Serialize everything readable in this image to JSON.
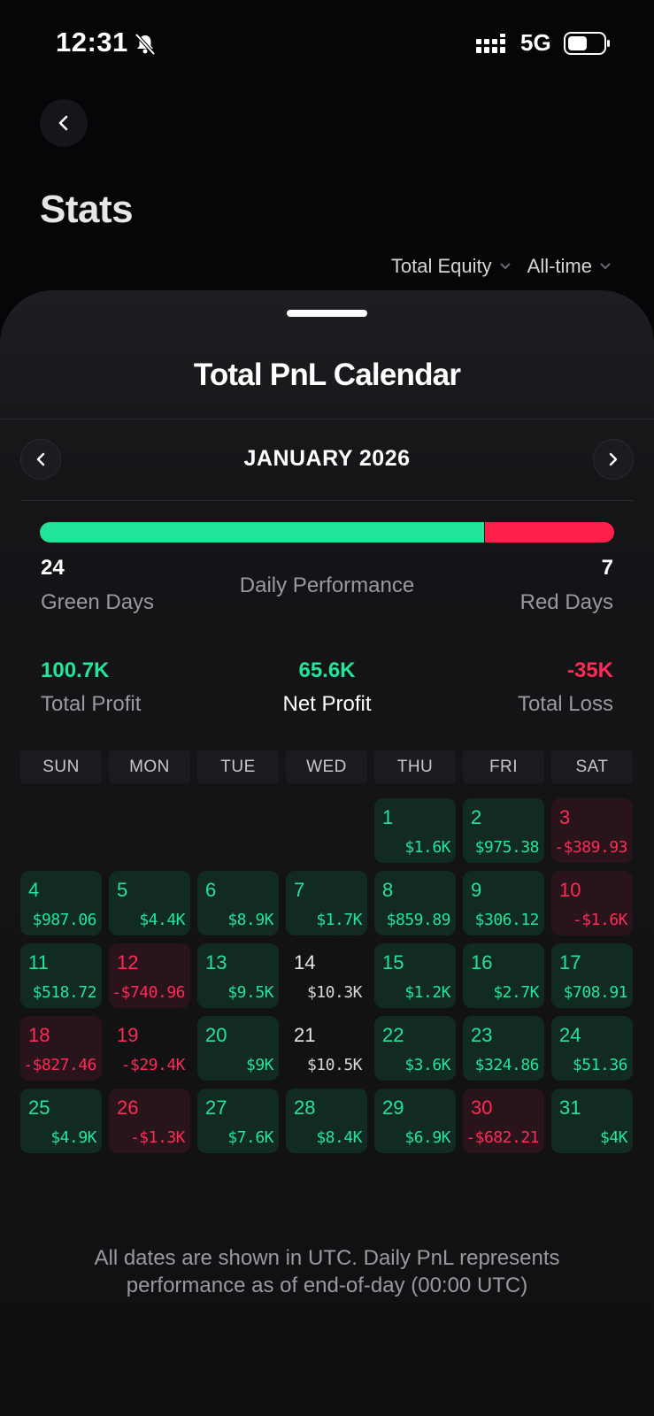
{
  "status_bar": {
    "time": "12:31",
    "network": "5G"
  },
  "header": {
    "title": "Stats"
  },
  "filters": {
    "metric": "Total Equity",
    "range": "All-time"
  },
  "sheet": {
    "title": "Total PnL Calendar",
    "month": "JANUARY 2026"
  },
  "performance": {
    "green_days": "24",
    "green_label": "Green Days",
    "center_label": "Daily Performance",
    "red_days": "7",
    "red_label": "Red Days",
    "green_fraction": 0.774
  },
  "summary": {
    "total_profit": "100.7K",
    "total_profit_label": "Total Profit",
    "net_profit": "65.6K",
    "net_profit_label": "Net Profit",
    "total_loss": "-35K",
    "total_loss_label": "Total Loss"
  },
  "weekdays": [
    "SUN",
    "MON",
    "TUE",
    "WED",
    "THU",
    "FRI",
    "SAT"
  ],
  "calendar": {
    "first_weekday": 4,
    "days": [
      {
        "day": "1",
        "pnl": "$1.6K",
        "type": "pos"
      },
      {
        "day": "2",
        "pnl": "$975.38",
        "type": "pos"
      },
      {
        "day": "3",
        "pnl": "-$389.93",
        "type": "neg"
      },
      {
        "day": "4",
        "pnl": "$987.06",
        "type": "pos"
      },
      {
        "day": "5",
        "pnl": "$4.4K",
        "type": "pos"
      },
      {
        "day": "6",
        "pnl": "$8.9K",
        "type": "pos"
      },
      {
        "day": "7",
        "pnl": "$1.7K",
        "type": "pos"
      },
      {
        "day": "8",
        "pnl": "$859.89",
        "type": "pos"
      },
      {
        "day": "9",
        "pnl": "$306.12",
        "type": "pos"
      },
      {
        "day": "10",
        "pnl": "-$1.6K",
        "type": "neg"
      },
      {
        "day": "11",
        "pnl": "$518.72",
        "type": "pos"
      },
      {
        "day": "12",
        "pnl": "-$740.96",
        "type": "neg"
      },
      {
        "day": "13",
        "pnl": "$9.5K",
        "type": "pos"
      },
      {
        "day": "14",
        "pnl": "$10.3K",
        "type": "plain-up"
      },
      {
        "day": "15",
        "pnl": "$1.2K",
        "type": "pos"
      },
      {
        "day": "16",
        "pnl": "$2.7K",
        "type": "pos"
      },
      {
        "day": "17",
        "pnl": "$708.91",
        "type": "pos"
      },
      {
        "day": "18",
        "pnl": "-$827.46",
        "type": "neg"
      },
      {
        "day": "19",
        "pnl": "-$29.4K",
        "type": "plain-dn"
      },
      {
        "day": "20",
        "pnl": "$9K",
        "type": "pos"
      },
      {
        "day": "21",
        "pnl": "$10.5K",
        "type": "plain-up"
      },
      {
        "day": "22",
        "pnl": "$3.6K",
        "type": "pos"
      },
      {
        "day": "23",
        "pnl": "$324.86",
        "type": "pos"
      },
      {
        "day": "24",
        "pnl": "$51.36",
        "type": "pos"
      },
      {
        "day": "25",
        "pnl": "$4.9K",
        "type": "pos"
      },
      {
        "day": "26",
        "pnl": "-$1.3K",
        "type": "neg"
      },
      {
        "day": "27",
        "pnl": "$7.6K",
        "type": "pos"
      },
      {
        "day": "28",
        "pnl": "$8.4K",
        "type": "pos"
      },
      {
        "day": "29",
        "pnl": "$6.9K",
        "type": "pos"
      },
      {
        "day": "30",
        "pnl": "-$682.21",
        "type": "neg"
      },
      {
        "day": "31",
        "pnl": "$4K",
        "type": "pos"
      }
    ]
  },
  "footnote": "All dates are shown in UTC. Daily PnL represents performance as of end-of-day (00:00 UTC)",
  "colors": {
    "green": "#23e59a",
    "red": "#ff1f4b",
    "background": "#060608"
  }
}
